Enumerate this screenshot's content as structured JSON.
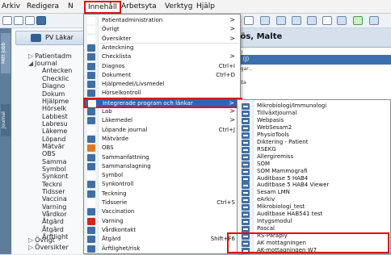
{
  "menubar": {
    "items": [
      "Arkiv",
      "Redigera",
      "N",
      "Innehåll",
      "Arbetsyta",
      "Verktyg",
      "Hjälp"
    ],
    "active_index": 3
  },
  "left_tabs": [
    "Mitt jobb",
    "Journal"
  ],
  "nav": {
    "patient_label": "PV Läkar",
    "tree": [
      {
        "label": "Patientadm",
        "level": 1,
        "arrow": "▷"
      },
      {
        "label": "Journal",
        "level": 1,
        "arrow": "◢"
      },
      {
        "label": "Antecken",
        "level": 2
      },
      {
        "label": "Checklic",
        "level": 2
      },
      {
        "label": "Diagno",
        "level": 2
      },
      {
        "label": "Dokum",
        "level": 2
      },
      {
        "label": "Hjälpme",
        "level": 2
      },
      {
        "label": "Hörselk",
        "level": 2
      },
      {
        "label": "Labbest",
        "level": 2
      },
      {
        "label": "Labresu",
        "level": 2
      },
      {
        "label": "Läkeme",
        "level": 2
      },
      {
        "label": "Löpand",
        "level": 2
      },
      {
        "label": "Mätvär",
        "level": 2
      },
      {
        "label": "OBS",
        "level": 2
      },
      {
        "label": "Samma",
        "level": 2
      },
      {
        "label": "Symbol",
        "level": 2
      },
      {
        "label": "Synkont",
        "level": 2
      },
      {
        "label": "Teckni",
        "level": 2
      },
      {
        "label": "Tidsser",
        "level": 2
      },
      {
        "label": "Vaccina",
        "level": 2
      },
      {
        "label": "Varning",
        "level": 2
      },
      {
        "label": "Vårdkor",
        "level": 2
      },
      {
        "label": "Åtgärd",
        "level": 2
      },
      {
        "label": "Åtgärd",
        "level": 2
      },
      {
        "label": "Ärftlight",
        "level": 2
      },
      {
        "label": "Övrigt",
        "level": 1,
        "arrow": "▷"
      },
      {
        "label": "Översikter",
        "level": 1,
        "arrow": "▷"
      }
    ]
  },
  "right": {
    "patient_name": "vetslös, Malte",
    "sub1": "(J)",
    "sub2": "d (J)",
    "sub3": "ngar...",
    "sub4": "ista"
  },
  "menu": {
    "items": [
      {
        "label": "Patientadministration",
        "shortcut": "",
        "sub": ">",
        "icon_color": "#ffffff"
      },
      {
        "label": "Övrigt",
        "shortcut": "",
        "sub": ">",
        "icon_color": "#ffffff"
      },
      {
        "label": "Översikter",
        "shortcut": "",
        "sub": ">",
        "icon_color": "#ffffff"
      },
      {
        "label": "Anteckning",
        "shortcut": "",
        "sub": "",
        "icon_color": "#3f6fa4"
      },
      {
        "label": "Checklista",
        "shortcut": "",
        "sub": ">",
        "icon_color": "#3f6fa4"
      },
      {
        "label": "Diagnos",
        "shortcut": "Ctrl+I",
        "sub": "",
        "icon_color": "#3f6fa4"
      },
      {
        "label": "Dokument",
        "shortcut": "Ctrl+D",
        "sub": "",
        "icon_color": "#3f6fa4"
      },
      {
        "label": "Hjälpmedel/Livsmedel",
        "shortcut": "",
        "sub": "",
        "icon_color": "#3f6fa4"
      },
      {
        "label": "Hörselkontroll",
        "shortcut": "",
        "sub": "",
        "icon_color": "#3f6fa4"
      },
      {
        "label": "Integrerade program och länkar",
        "shortcut": "",
        "sub": ">",
        "icon_color": "#ffffff",
        "highlight": true
      },
      {
        "label": "Lab",
        "shortcut": "",
        "sub": ">",
        "icon_color": "#3f6fa4"
      },
      {
        "label": "Läkemedel",
        "shortcut": "",
        "sub": ">",
        "icon_color": "#3f6fa4"
      },
      {
        "label": "Löpande journal",
        "shortcut": "Ctrl+J",
        "sub": "",
        "icon_color": "#ffffff"
      },
      {
        "label": "Mätvärde",
        "shortcut": "",
        "sub": "",
        "icon_color": "#3f6fa4"
      },
      {
        "label": "OBS",
        "shortcut": "",
        "sub": "",
        "icon_color": "#e07a1f"
      },
      {
        "label": "Sammanfattning",
        "shortcut": "",
        "sub": "",
        "icon_color": "#3f6fa4"
      },
      {
        "label": "Sammanslagning",
        "shortcut": "",
        "sub": "",
        "icon_color": "#3f6fa4"
      },
      {
        "label": "Symbol",
        "shortcut": "",
        "sub": "",
        "icon_color": "#ffffff"
      },
      {
        "label": "Synkontroll",
        "shortcut": "",
        "sub": "",
        "icon_color": "#3f6fa4"
      },
      {
        "label": "Teckning",
        "shortcut": "",
        "sub": "",
        "icon_color": "#3f6fa4"
      },
      {
        "label": "Tidsserie",
        "shortcut": "Ctrl+S",
        "sub": "",
        "icon_color": "#ffffff"
      },
      {
        "label": "Vaccination",
        "shortcut": "",
        "sub": "",
        "icon_color": "#3f6fa4"
      },
      {
        "label": "Varning",
        "shortcut": "",
        "sub": "",
        "icon_color": "#d9241c"
      },
      {
        "label": "Vårdkontakt",
        "shortcut": "",
        "sub": "",
        "icon_color": "#3f6fa4"
      },
      {
        "label": "Åtgärd",
        "shortcut": "Shift+F6",
        "sub": "",
        "icon_color": "#3f6fa4"
      },
      {
        "label": "Ärftlighet/risk",
        "shortcut": "",
        "sub": "",
        "icon_color": "#3f6fa4"
      }
    ]
  },
  "submenu": {
    "items": [
      "Mikrobiologi/Immunologi",
      "Tillväxtjournal",
      "Webpasis",
      "WebSesam2",
      "PhysioTools",
      "Diktering - Patient",
      "RSEKG",
      "Allergiremiss",
      "SOM",
      "SOM Mammografi",
      "Auditbase 5 HAB4",
      "Auditbase 5 HAB4 Viewer",
      "Sesam LMN",
      "eArkiv",
      "Mikrobiologi_test",
      "Auditbase HAB541 test",
      "Intygsmodul",
      "Pascal",
      "RS-Paraply",
      "AK mottagningen",
      "AK-mottagningen W7"
    ]
  }
}
